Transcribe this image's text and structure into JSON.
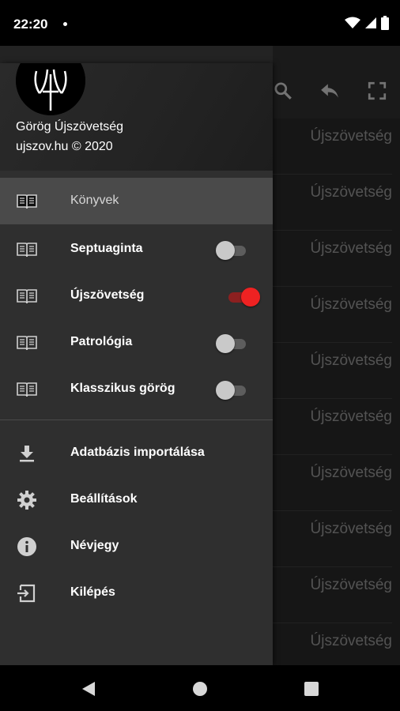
{
  "status_bar": {
    "time": "22:20"
  },
  "app": {
    "list_items": [
      "Újszövetség",
      "Újszövetség",
      "Újszövetség",
      "Újszövetség",
      "Újszövetség",
      "Újszövetség",
      "Újszövetség",
      "Újszövetség",
      "Újszövetség",
      "Újszövetség"
    ],
    "actions": [
      "search-icon",
      "reply-icon",
      "fullscreen-icon"
    ]
  },
  "drawer": {
    "header": {
      "title": "Görög Újszövetség",
      "subtitle": "ujszov.hu © 2020"
    },
    "books": [
      {
        "label": "Könyvek",
        "icon": "book-icon",
        "selected": true
      },
      {
        "label": "Septuaginta",
        "icon": "book-icon",
        "toggle": false
      },
      {
        "label": "Újszövetség",
        "icon": "book-icon",
        "toggle": true
      },
      {
        "label": "Patrológia",
        "icon": "book-icon",
        "toggle": false
      },
      {
        "label": "Klasszikus görög",
        "icon": "book-icon",
        "toggle": false
      }
    ],
    "menu": [
      {
        "label": "Adatbázis importálása",
        "icon": "download-icon"
      },
      {
        "label": "Beállítások",
        "icon": "gear-icon"
      },
      {
        "label": "Névjegy",
        "icon": "info-icon"
      },
      {
        "label": "Kilépés",
        "icon": "exit-icon"
      }
    ]
  },
  "colors": {
    "accent": "#ee2222",
    "drawer_bg": "#2f2f2f",
    "selected_bg": "#4a4a4a"
  }
}
